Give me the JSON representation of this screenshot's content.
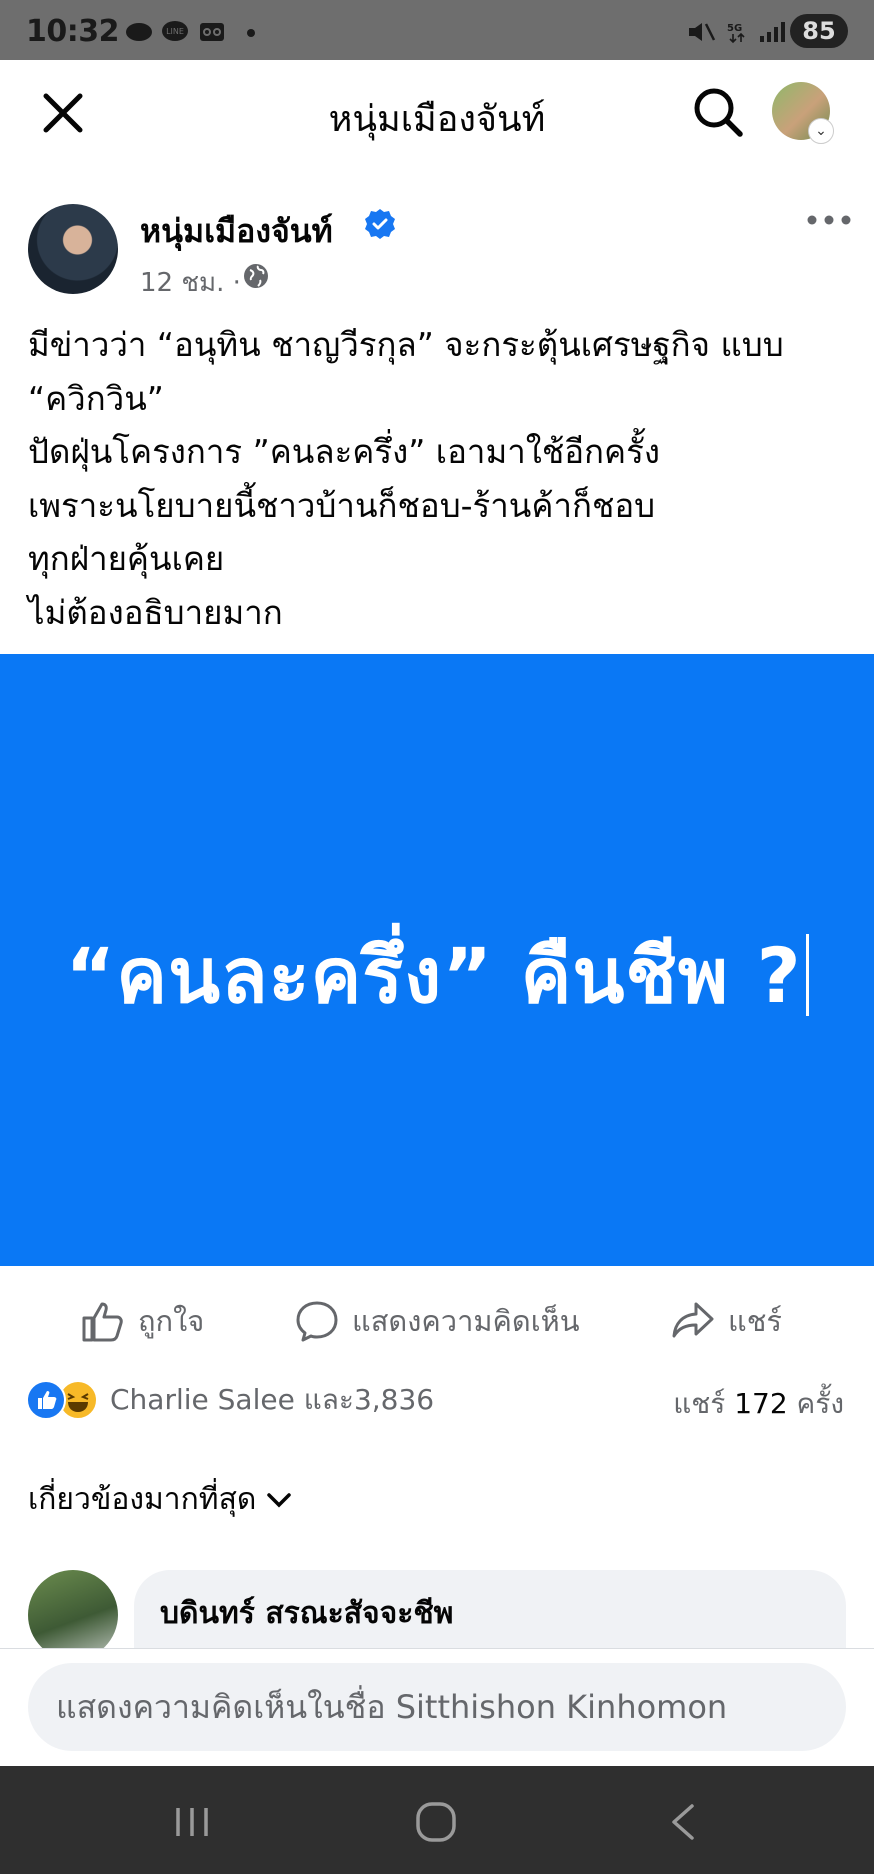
{
  "status_bar": {
    "time": "10:32",
    "battery": "85",
    "network": "5G"
  },
  "app_bar": {
    "title": "หนุ่มเมืองจันท์",
    "icons": [
      "close-icon",
      "search-icon",
      "profile-avatar"
    ]
  },
  "post": {
    "author": "หนุ่มเมืองจันท์",
    "verified": true,
    "time": "12 ชม. ·",
    "text": "มีข่าวว่า “อนุทิน ชาญวีรกุล” จะกระตุ้นเศรษฐกิจ แบบ\n“ควิกวิน”\nปัดฝุ่นโครงการ ”คนละครึ่ง” เอามาใช้อีกครั้ง\nเพราะนโยบายนี้ชาวบ้านก็ชอบ-ร้านค้าก็ชอบ\nทุกฝ่ายคุ้นเคย\nไม่ต้องอธิบายมาก",
    "image_text": "“คนละครึ่ง” คืนชีพ ?",
    "image_bg": "#0a78f5"
  },
  "actions": {
    "like": "ถูกใจ",
    "comment": "แสดงความคิดเห็น",
    "share": "แชร์"
  },
  "reactions": {
    "summary": "Charlie Salee และ3,836",
    "shares_label": "แชร์",
    "shares_count": "172",
    "shares_unit": "ครั้ง"
  },
  "comments": {
    "sort_label": "เกี่ยวข้องมากที่สุด",
    "items": [
      {
        "name": "บดินทร์ สรณะสัจจะชีพ"
      }
    ]
  },
  "composer": {
    "placeholder": "แสดงความคิดเห็นในชื่อ Sitthishon Kinhomon"
  },
  "colors": {
    "accent": "#1877f2",
    "text_secondary": "#65676b"
  }
}
